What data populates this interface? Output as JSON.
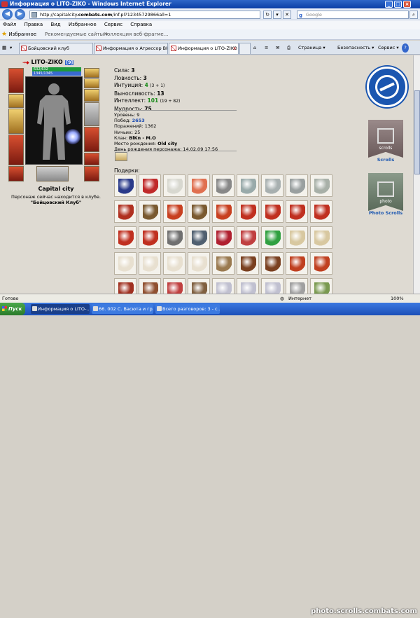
{
  "window": {
    "title": "Информация о LITO-ZIKO - Windows Internet Explorer"
  },
  "address": {
    "url_prefix": "http://capitalcity.",
    "url_domain": "combats.com",
    "url_path": "/inf.pl?12345729866all=1"
  },
  "search": {
    "placeholder": "Google"
  },
  "menu": [
    "Файл",
    "Правка",
    "Вид",
    "Избранное",
    "Сервис",
    "Справка"
  ],
  "favorites": {
    "label": "Избранное",
    "links": [
      "Рекомендуемые сайты ▾",
      "Коллекция веб-фрагме..."
    ]
  },
  "tabs": [
    {
      "label": "Бойцовский клуб"
    },
    {
      "label": "Информация о Агрессор ВК"
    },
    {
      "label": "Информация о LITO-ZIKO"
    }
  ],
  "toolbar_right": {
    "page": "Страница ▾",
    "safety": "Безопасность ▾",
    "tools": "Сервис ▾",
    "help": "?"
  },
  "character": {
    "name": "LITO-ZIKO",
    "level": "[9]",
    "hp": "632/632",
    "mp": "1345/1345",
    "city": "Capital city",
    "location_line": "Персонаж сейчас находится в клубе.",
    "club": "\"Бойцовский Клуб\""
  },
  "stats": {
    "strength": {
      "label": "Сила:",
      "value": "3"
    },
    "agility": {
      "label": "Ловкость:",
      "value": "3"
    },
    "intuition": {
      "label": "Интуиция:",
      "value": "4",
      "extra": "(3 + 1)"
    },
    "endurance": {
      "label": "Выносливость:",
      "value": "13"
    },
    "intellect": {
      "label": "Интеллект:",
      "value": "101",
      "extra": "(19 + 82)"
    },
    "wisdom": {
      "label": "Мудрость:",
      "value": "75"
    }
  },
  "info": {
    "level": "Уровень: 9",
    "wins_label": "Побед: ",
    "wins": "2653",
    "losses": "Поражений: 1362",
    "draws": "Ничьих: 25",
    "clan_label": "Клан: ",
    "clan": "BlKn - M.O",
    "birthplace_label": "Место рождения: ",
    "birthplace": "Old city",
    "birthday": "День рождения персонажа: 14.02.09 17:56"
  },
  "gifts": {
    "label": "Подарки:"
  },
  "sidebar": {
    "scrolls_label": "Scrolls",
    "photo_label": "Photo Scrolls",
    "banner1_text": "scrolls",
    "banner2_text": "photo"
  },
  "status": {
    "ready": "Готово",
    "zone": "Интернет",
    "zoom": "100%"
  },
  "taskbar": {
    "start": "Пуск",
    "items": [
      "Информация о LITO-...",
      "66. 002 С. Васюта и гр....",
      "Всего разговоров: 3 - с..."
    ]
  },
  "watermark": "photo.scrolls.combats.com"
}
